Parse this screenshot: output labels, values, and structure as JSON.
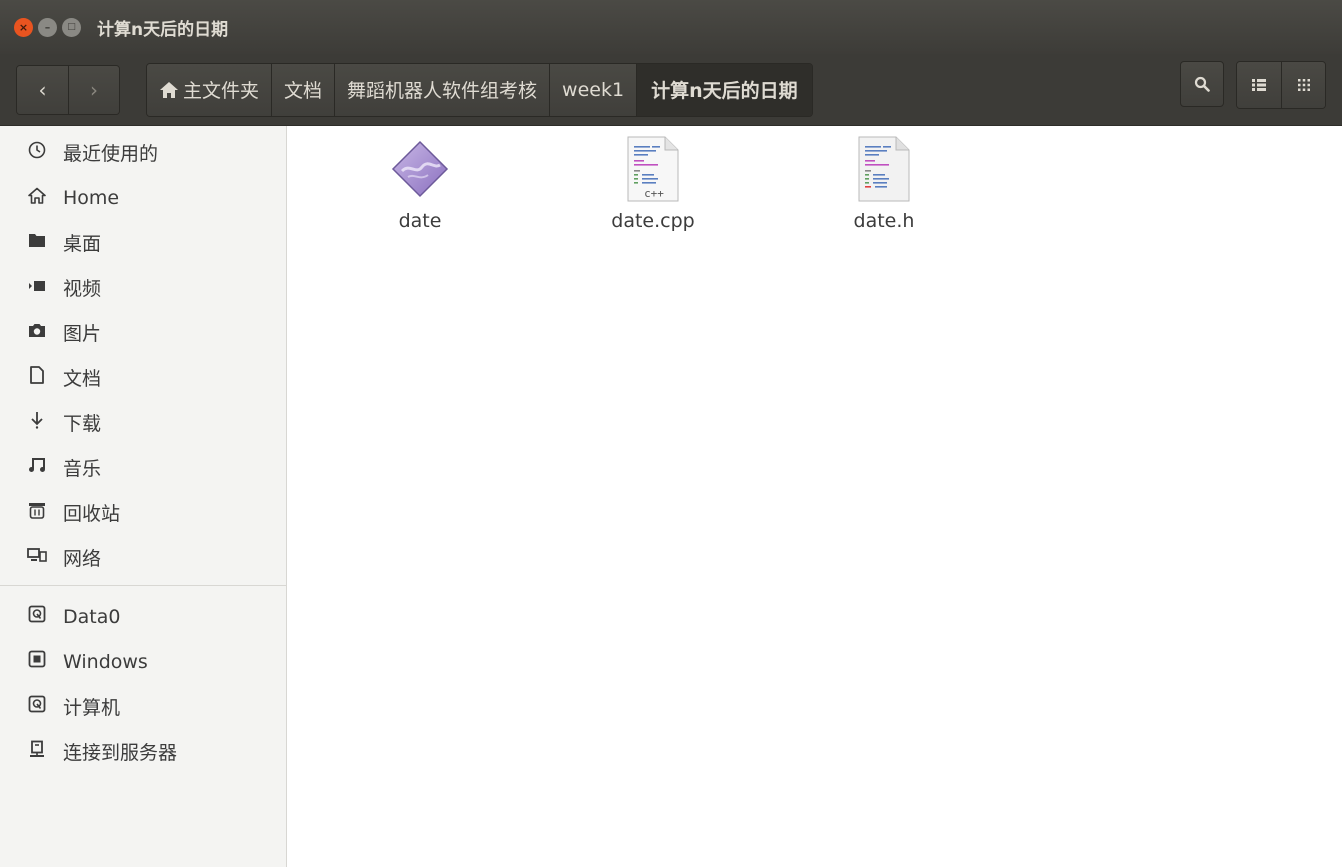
{
  "window": {
    "title": "计算n天后的日期",
    "close_glyph": "×",
    "minimize_glyph": "–",
    "maximize_glyph": "□"
  },
  "toolbar": {
    "back_glyph": "‹",
    "forward_glyph": "›",
    "breadcrumbs": [
      {
        "label": "主文件夹",
        "icon": "home-icon"
      },
      {
        "label": "文档"
      },
      {
        "label": "舞蹈机器人软件组考核"
      },
      {
        "label": "week1"
      },
      {
        "label": "计算n天后的日期"
      }
    ]
  },
  "sidebar": {
    "places": [
      {
        "label": "最近使用的",
        "icon": "clock-icon"
      },
      {
        "label": "Home",
        "icon": "home-icon"
      },
      {
        "label": "桌面",
        "icon": "folder-icon"
      },
      {
        "label": "视频",
        "icon": "video-icon"
      },
      {
        "label": "图片",
        "icon": "camera-icon"
      },
      {
        "label": "文档",
        "icon": "document-icon"
      },
      {
        "label": "下载",
        "icon": "download-icon"
      },
      {
        "label": "音乐",
        "icon": "music-icon"
      },
      {
        "label": "回收站",
        "icon": "trash-icon"
      },
      {
        "label": "网络",
        "icon": "network-icon"
      }
    ],
    "devices": [
      {
        "label": "Data0",
        "icon": "drive-icon"
      },
      {
        "label": "Windows",
        "icon": "chip-drive-icon"
      },
      {
        "label": "计算机",
        "icon": "drive-icon"
      },
      {
        "label": "连接到服务器",
        "icon": "server-icon"
      }
    ]
  },
  "files": [
    {
      "name": "date",
      "icon": "executable-icon"
    },
    {
      "name": "date.cpp",
      "icon": "cpp-source-icon",
      "badge": "c++"
    },
    {
      "name": "date.h",
      "icon": "header-source-icon"
    }
  ],
  "colors": {
    "accent_close": "#e95420",
    "toolbar_bg": "#3c3b37",
    "sidebar_bg": "#f4f4f2"
  }
}
